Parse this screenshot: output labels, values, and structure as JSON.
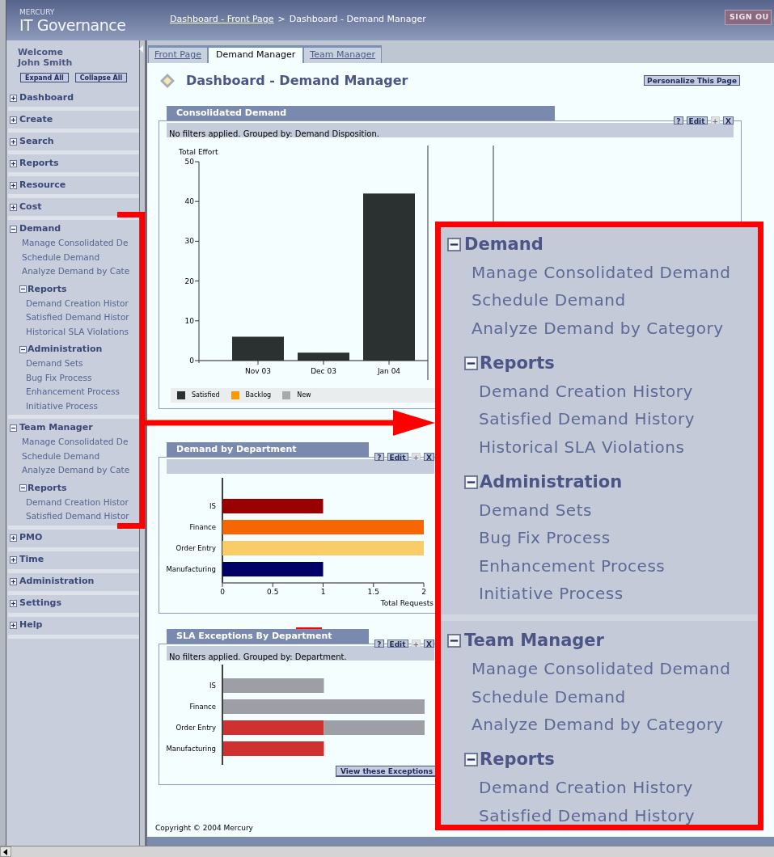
{
  "header": {
    "brand_small": "MERCURY",
    "brand": "IT Governance",
    "breadcrumb": [
      {
        "kind": "link",
        "label": "Dashboard - Front Page"
      },
      {
        "kind": "separator",
        "label": ">"
      },
      {
        "kind": "current",
        "label": "Dashboard - Demand Manager"
      }
    ],
    "sign_out": "SIGN OU"
  },
  "sidebar": {
    "welcome": "Welcome",
    "user": "John Smith",
    "buttons": [
      "Expand All",
      "Collapse All"
    ],
    "items": [
      {
        "kind": "group",
        "label": "Dashboard",
        "expanded": false
      },
      {
        "kind": "group",
        "label": "Create",
        "expanded": false
      },
      {
        "kind": "group",
        "label": "Search",
        "expanded": false
      },
      {
        "kind": "group",
        "label": "Reports",
        "expanded": false
      },
      {
        "kind": "group",
        "label": "Resource",
        "expanded": false
      },
      {
        "kind": "group",
        "label": "Cost",
        "expanded": false
      },
      {
        "kind": "group",
        "label": "Demand",
        "expanded": true,
        "children": [
          {
            "kind": "link",
            "label": "Manage Consolidated De"
          },
          {
            "kind": "link",
            "label": "Schedule Demand"
          },
          {
            "kind": "link",
            "label": "Analyze Demand by Cate"
          },
          {
            "kind": "group",
            "label": "Reports",
            "expanded": true,
            "children": [
              {
                "kind": "link",
                "label": "Demand Creation Histor"
              },
              {
                "kind": "link",
                "label": "Satisfied Demand Histor"
              },
              {
                "kind": "link",
                "label": "Historical SLA Violations"
              }
            ]
          },
          {
            "kind": "group",
            "label": "Administration",
            "expanded": true,
            "children": [
              {
                "kind": "link",
                "label": "Demand Sets"
              },
              {
                "kind": "link",
                "label": "Bug Fix Process"
              },
              {
                "kind": "link",
                "label": "Enhancement Process"
              },
              {
                "kind": "link",
                "label": "Initiative Process"
              }
            ]
          }
        ]
      },
      {
        "kind": "group",
        "label": "Team Manager",
        "expanded": true,
        "children": [
          {
            "kind": "link",
            "label": "Manage Consolidated De"
          },
          {
            "kind": "link",
            "label": "Schedule Demand"
          },
          {
            "kind": "link",
            "label": "Analyze Demand by Cate"
          },
          {
            "kind": "group",
            "label": "Reports",
            "expanded": true,
            "children": [
              {
                "kind": "link",
                "label": "Demand Creation Histor"
              },
              {
                "kind": "link",
                "label": "Satisfied Demand Histor"
              }
            ]
          }
        ]
      },
      {
        "kind": "group",
        "label": "PMO",
        "expanded": false
      },
      {
        "kind": "group",
        "label": "Time",
        "expanded": false
      },
      {
        "kind": "group",
        "label": "Administration",
        "expanded": false
      },
      {
        "kind": "group",
        "label": "Settings",
        "expanded": false
      },
      {
        "kind": "group",
        "label": "Help",
        "expanded": false
      }
    ]
  },
  "tabs": [
    {
      "label": "Front Page",
      "selected": false
    },
    {
      "label": "Demand Manager",
      "selected": true
    },
    {
      "label": "Team Manager",
      "selected": false
    }
  ],
  "page_title": "Dashboard - Demand Manager",
  "personalize_button": "Personalize This Page",
  "panels": [
    {
      "kind": "column_chart",
      "title": "Consolidated Demand",
      "filter_text": "No filters applied. Grouped by: Demand Disposition.",
      "tools": [
        {
          "label": "?",
          "disabled": false
        },
        {
          "label": "Edit",
          "disabled": false
        },
        {
          "label": "+",
          "disabled": true
        },
        {
          "label": "X",
          "disabled": false
        }
      ],
      "chart_data": {
        "type": "bar",
        "ylabel": "Total Effort",
        "categories": [
          "Nov 03",
          "Dec 03",
          "Jan 04"
        ],
        "ylim": [
          0,
          50
        ],
        "yticks": [
          0,
          10,
          20,
          30,
          40,
          50
        ],
        "stacked": true,
        "series": [
          {
            "name": "Satisfied",
            "color": "#2b3030",
            "values": [
              6,
              2,
              42
            ]
          },
          {
            "name": "Backlog",
            "color": "#f59a00",
            "values": [
              0,
              0,
              0
            ]
          },
          {
            "name": "New",
            "color": "#a8aaaa",
            "values": [
              0,
              0,
              0
            ]
          }
        ]
      }
    },
    {
      "kind": "bar_chart",
      "title": "Demand by Department",
      "tools": [
        {
          "label": "?",
          "disabled": false
        },
        {
          "label": "Edit",
          "disabled": false
        },
        {
          "label": "+",
          "disabled": true
        },
        {
          "label": "X",
          "disabled": false
        }
      ],
      "chart_data": {
        "type": "bar",
        "orientation": "horizontal",
        "xlabel": "Total Requests",
        "categories": [
          "IS",
          "Finance",
          "Order Entry",
          "Manufacturing"
        ],
        "xlim": [
          0,
          2
        ],
        "xticks": [
          0,
          {
            "value": 0.5,
            "label": "0.5"
          },
          1,
          {
            "value": 1.5,
            "label": "1.5"
          },
          2
        ],
        "stacked": true,
        "series": [
          {
            "color": "#990000",
            "values": [
              1,
              null,
              null,
              null
            ]
          },
          {
            "color": "#f66605",
            "values": [
              null,
              2,
              null,
              null
            ]
          },
          {
            "color": "#f8cc66",
            "values": [
              null,
              null,
              2,
              null
            ]
          },
          {
            "color": "#000066",
            "values": [
              null,
              null,
              null,
              1
            ]
          }
        ]
      }
    },
    {
      "kind": "bar_picture",
      "title": "SLA Exceptions By Department",
      "filter_text": "No filters applied. Grouped by: Department.",
      "tools": [
        {
          "label": "?",
          "disabled": false
        },
        {
          "label": "Edit",
          "disabled": false
        },
        {
          "label": "+",
          "disabled": true
        },
        {
          "label": "X",
          "disabled": false
        }
      ],
      "categories": [
        "IS",
        "Finance",
        "Order Entry",
        "Manufacturing"
      ],
      "button": "View these Exceptions"
    }
  ],
  "footer": "Copyright © 2004 Mercury",
  "callout": {
    "items": [
      {
        "kind": "group",
        "label": "Demand",
        "expanded": true,
        "children": [
          {
            "kind": "link",
            "label": "Manage Consolidated Demand"
          },
          {
            "kind": "link",
            "label": "Schedule Demand"
          },
          {
            "kind": "link",
            "label": "Analyze Demand by Category"
          },
          {
            "kind": "group",
            "label": "Reports",
            "expanded": true,
            "children": [
              {
                "kind": "link",
                "label": "Demand Creation History"
              },
              {
                "kind": "link",
                "label": "Satisfied Demand History"
              },
              {
                "kind": "link",
                "label": "Historical SLA Violations"
              }
            ]
          },
          {
            "kind": "group",
            "label": "Administration",
            "expanded": true,
            "children": [
              {
                "kind": "link",
                "label": "Demand Sets"
              },
              {
                "kind": "link",
                "label": "Bug Fix Process"
              },
              {
                "kind": "link",
                "label": "Enhancement Process"
              },
              {
                "kind": "link",
                "label": "Initiative Process"
              }
            ]
          }
        ]
      },
      {
        "kind": "group",
        "label": "Team Manager",
        "expanded": true,
        "children": [
          {
            "kind": "link",
            "label": "Manage Consolidated Demand"
          },
          {
            "kind": "link",
            "label": "Schedule Demand"
          },
          {
            "kind": "link",
            "label": "Analyze Demand by Category"
          },
          {
            "kind": "group",
            "label": "Reports",
            "expanded": true,
            "children": [
              {
                "kind": "link",
                "label": "Demand Creation History"
              },
              {
                "kind": "link",
                "label": "Satisfied Demand History"
              }
            ]
          }
        ]
      }
    ]
  }
}
